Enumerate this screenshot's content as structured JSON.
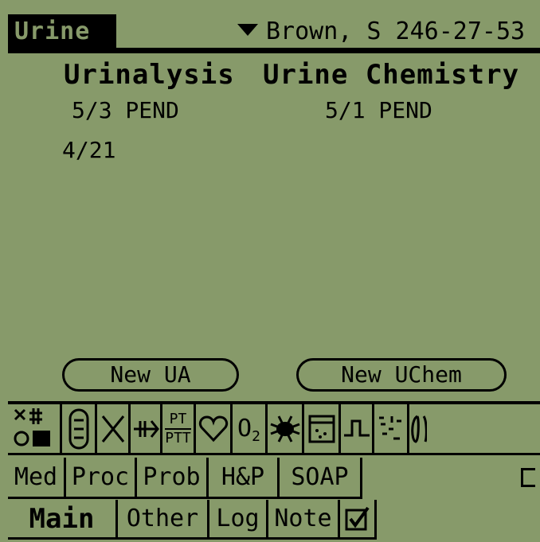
{
  "header": {
    "title": "Urine",
    "patient": "Brown, S 246-27-53"
  },
  "columns": [
    {
      "heading": "Urinalysis",
      "rows": [
        "5/3 PEND",
        "4/21"
      ]
    },
    {
      "heading": "Urine Chemistry",
      "rows": [
        "5/1 PEND"
      ]
    }
  ],
  "buttons": {
    "new_ua": "New UA",
    "new_uchem": "New UChem"
  },
  "toolbar_icons": [
    "hematology-icon",
    "capsule-icon",
    "cross-icon",
    "arrows-icon",
    "pt-ptt-icon",
    "heart-icon",
    "o2-icon",
    "bug-icon",
    "urine-cup-icon",
    "peak-icon",
    "scatter-icon",
    "lungs-icon"
  ],
  "pt_ptt": {
    "top": "PT",
    "bottom": "PTT"
  },
  "o2": {
    "o": "O",
    "sub": "2"
  },
  "row_tabs": [
    "Med",
    "Proc",
    "Prob",
    "H&P",
    "SOAP"
  ],
  "bottom_tabs": [
    "Main",
    "Other",
    "Log",
    "Note"
  ],
  "colors": {
    "screen": "#879a6a",
    "ink": "#000000"
  }
}
